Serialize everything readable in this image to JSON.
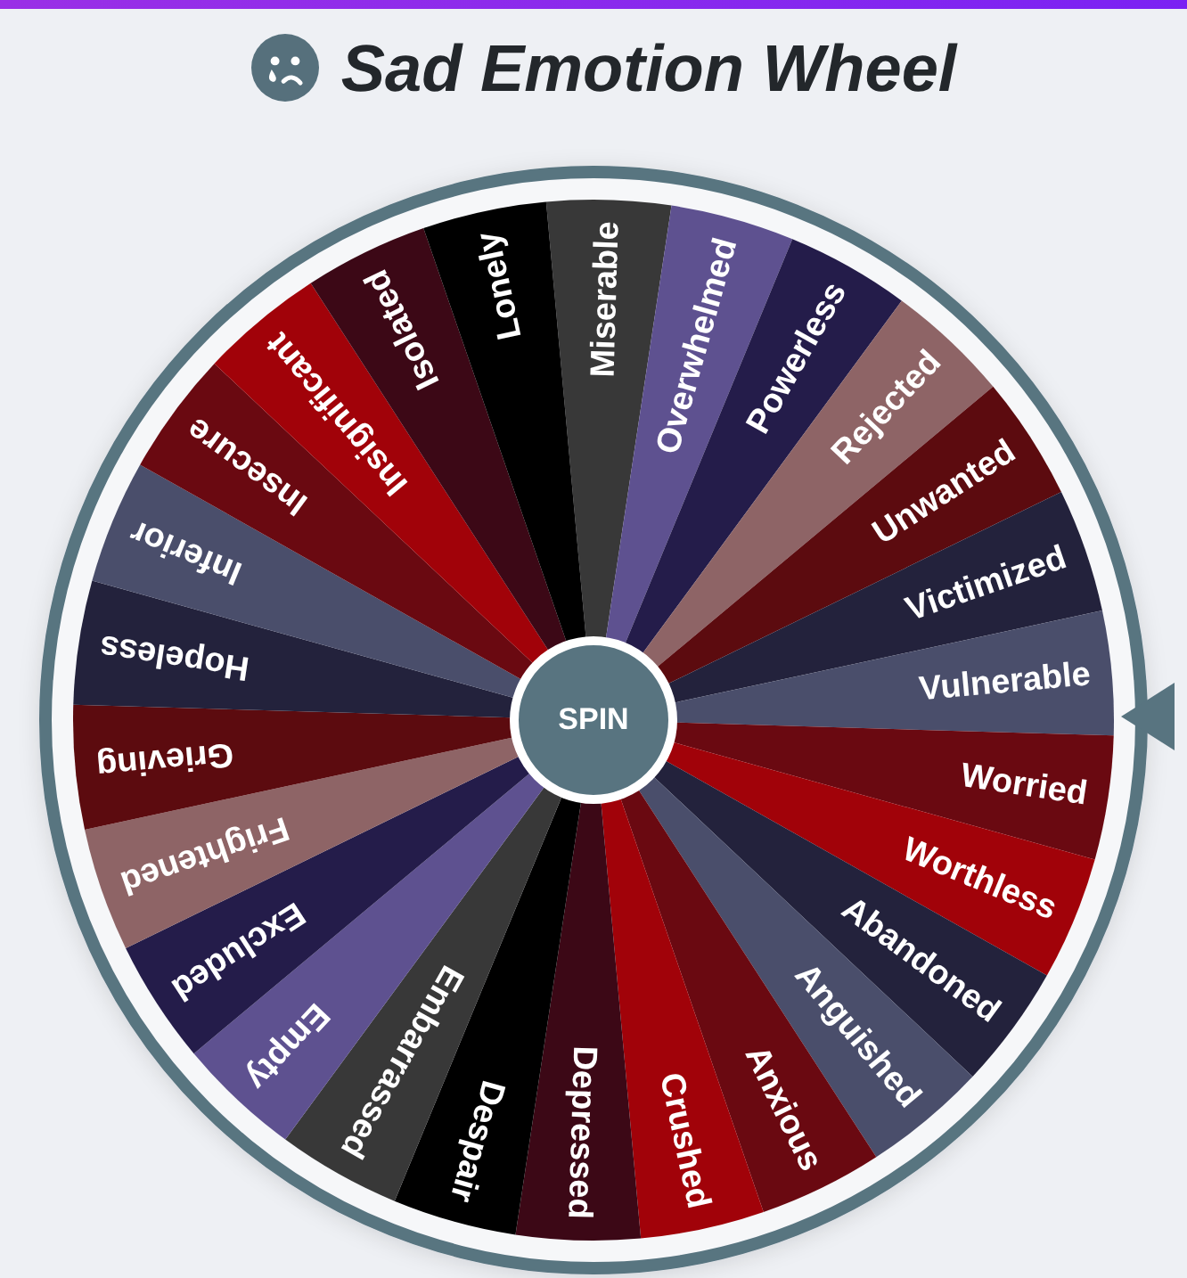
{
  "header": {
    "title": "Sad Emotion Wheel"
  },
  "wheel": {
    "segments": [
      {
        "label": "Miserable",
        "color": "#383838"
      },
      {
        "label": "Overwhelmed",
        "color": "#5e5190"
      },
      {
        "label": "Powerless",
        "color": "#241c4a"
      },
      {
        "label": "Rejected",
        "color": "#8e6466"
      },
      {
        "label": "Unwanted",
        "color": "#5c0b0f"
      },
      {
        "label": "Victimized",
        "color": "#23223c"
      },
      {
        "label": "Vulnerable",
        "color": "#4a4e6b"
      },
      {
        "label": "Worried",
        "color": "#6a0911"
      },
      {
        "label": "Worthless",
        "color": "#a10209"
      },
      {
        "label": "Abandoned",
        "color": "#23223c"
      },
      {
        "label": "Anguished",
        "color": "#4a4e6b"
      },
      {
        "label": "Anxious",
        "color": "#6a0911"
      },
      {
        "label": "Crushed",
        "color": "#a10209"
      },
      {
        "label": "Depressed",
        "color": "#3c0816"
      },
      {
        "label": "Despair",
        "color": "#000000"
      },
      {
        "label": "Embarrassed",
        "color": "#383838"
      },
      {
        "label": "Empty",
        "color": "#5e5190"
      },
      {
        "label": "Excluded",
        "color": "#241c4a"
      },
      {
        "label": "Frightened",
        "color": "#8e6466"
      },
      {
        "label": "Grieving",
        "color": "#5c0b0f"
      },
      {
        "label": "Hopeless",
        "color": "#23223c"
      },
      {
        "label": "Inferior",
        "color": "#4a4e6b"
      },
      {
        "label": "Insecure",
        "color": "#6a0911"
      },
      {
        "label": "Insignificant",
        "color": "#a10209"
      },
      {
        "label": "Isolated",
        "color": "#3c0816"
      },
      {
        "label": "Lonely",
        "color": "#000000"
      }
    ]
  },
  "spin_button": {
    "label": "SPIN"
  }
}
